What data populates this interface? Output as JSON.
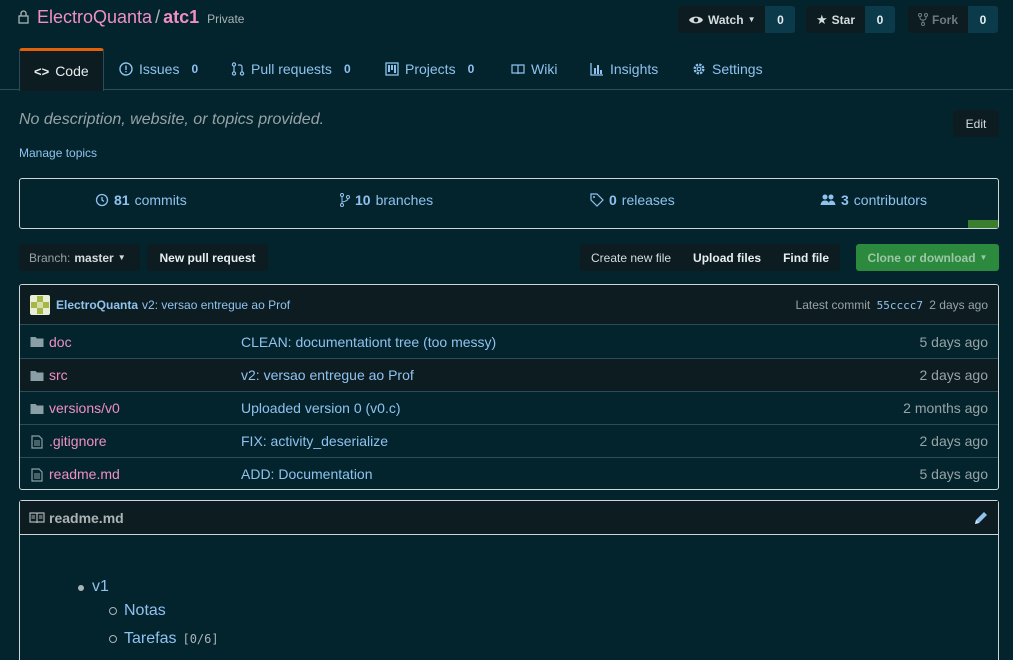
{
  "repo": {
    "owner": "ElectroQuanta",
    "separator": "/",
    "name": "atc1",
    "visibility": "Private"
  },
  "actions": {
    "watch": {
      "label": "Watch",
      "count": "0"
    },
    "star": {
      "label": "Star",
      "count": "0"
    },
    "fork": {
      "label": "Fork",
      "count": "0"
    }
  },
  "tabs": [
    {
      "label": "Code",
      "count": ""
    },
    {
      "label": "Issues",
      "count": "0"
    },
    {
      "label": "Pull requests",
      "count": "0"
    },
    {
      "label": "Projects",
      "count": "0"
    },
    {
      "label": "Wiki",
      "count": ""
    },
    {
      "label": "Insights",
      "count": ""
    },
    {
      "label": "Settings",
      "count": ""
    }
  ],
  "description": {
    "text": "No description, website, or topics provided.",
    "manage_topics": "Manage topics",
    "edit": "Edit"
  },
  "summary": {
    "commits": {
      "num": "81",
      "label": "commits"
    },
    "branches": {
      "num": "10",
      "label": "branches"
    },
    "releases": {
      "num": "0",
      "label": "releases"
    },
    "contributors": {
      "num": "3",
      "label": "contributors"
    }
  },
  "filenav": {
    "branch_prefix": "Branch:",
    "branch": "master",
    "new_pr": "New pull request",
    "create_file": "Create new file",
    "upload": "Upload files",
    "find": "Find file",
    "clone": "Clone or download"
  },
  "latest_commit": {
    "author": "ElectroQuanta",
    "message": "v2: versao entregue ao Prof",
    "prefix": "Latest commit",
    "sha": "55cccc7",
    "age": "2 days ago"
  },
  "files": [
    {
      "name": "doc",
      "type": "dir",
      "message": "CLEAN: documentationt tree (too messy)",
      "age": "5 days ago"
    },
    {
      "name": "src",
      "type": "dir",
      "message": "v2: versao entregue ao Prof",
      "age": "2 days ago"
    },
    {
      "name": "versions/v0",
      "type": "dir",
      "message": "Uploaded version 0 (v0.c)",
      "age": "2 months ago"
    },
    {
      "name": ".gitignore",
      "type": "file",
      "message": "FIX: activity_deserialize",
      "age": "2 days ago"
    },
    {
      "name": "readme.md",
      "type": "file",
      "message": "ADD: Documentation",
      "age": "5 days ago"
    }
  ],
  "readme": {
    "title": "readme.md",
    "items": [
      {
        "label": "v1",
        "children": [
          {
            "label": "Notas",
            "code": ""
          },
          {
            "label": "Tarefas",
            "code": "[0/6]"
          }
        ]
      }
    ]
  },
  "colors": {
    "accent_tab": "#e36209",
    "link": "#8fc2ee",
    "name": "#ef8fc5",
    "background": "#04242d"
  }
}
